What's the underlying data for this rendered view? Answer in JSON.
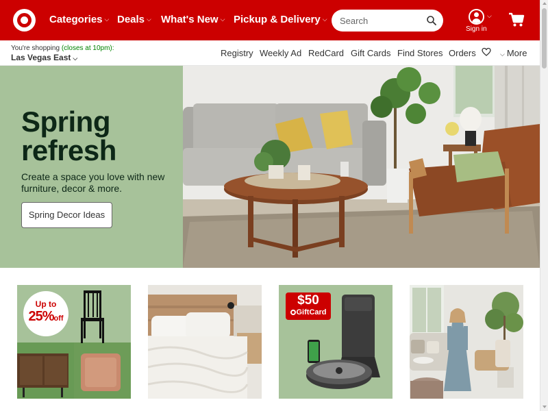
{
  "header": {
    "nav": [
      {
        "label": "Categories"
      },
      {
        "label": "Deals"
      },
      {
        "label": "What's New"
      },
      {
        "label": "Pickup & Delivery"
      }
    ],
    "search": {
      "placeholder": "Search"
    },
    "account": {
      "label": "Sign in"
    },
    "colors": {
      "brand": "#cc0000"
    }
  },
  "utility": {
    "shopping_prefix": "You're shopping",
    "store_hours": "(closes at 10pm):",
    "store_name": "Las Vegas East",
    "links": [
      "Registry",
      "Weekly Ad",
      "RedCard",
      "Gift Cards",
      "Find Stores",
      "Orders"
    ],
    "more_label": "More"
  },
  "hero": {
    "title_line1": "Spring",
    "title_line2": "refresh",
    "subtitle": "Create a space you love with new furniture, decor & more.",
    "button_label": "Spring Decor Ideas",
    "panel_color": "#a7c29a"
  },
  "tiles": {
    "tile1": {
      "badge_line1": "Up to",
      "badge_line2": "25%",
      "badge_suffix": "off"
    },
    "tile3": {
      "gc_amount": "$50",
      "gc_label": "GiftCard"
    }
  },
  "icons": {
    "logo": "target-bullseye-logo",
    "search": "search-icon",
    "account": "person-icon",
    "cart": "cart-icon",
    "favorites": "heart-icon"
  }
}
